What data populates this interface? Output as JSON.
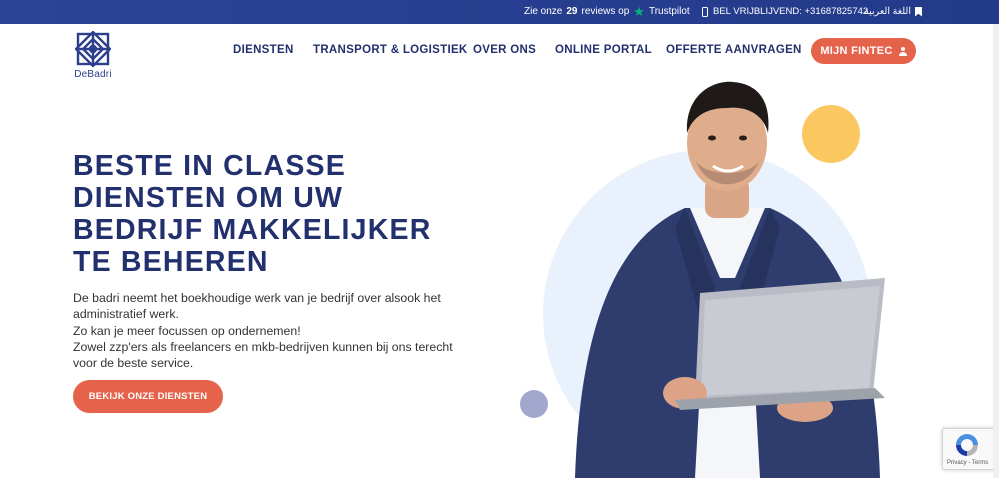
{
  "topbar": {
    "reviews_prefix": "Zie onze",
    "reviews_count": "29",
    "reviews_suffix": "reviews op",
    "trustpilot": "Trustpilot",
    "phone": "BEL VRIJBLIJVEND: +31687825742",
    "language": "اللغة العربية"
  },
  "logo": {
    "name": "DeBadri"
  },
  "nav": {
    "items": [
      {
        "label": "DIENSTEN"
      },
      {
        "label": "TRANSPORT & LOGISTIEK"
      },
      {
        "label": "OVER ONS"
      },
      {
        "label": "ONLINE PORTAL"
      },
      {
        "label": "OFFERTE AANVRAGEN"
      }
    ],
    "fintec_button": "MIJN FINTEC"
  },
  "hero": {
    "title_lines": [
      "BESTE IN CLASSE",
      "DIENSTEN OM UW",
      "BEDRIJF MAKKELIJKER",
      "TE BEHEREN"
    ],
    "paragraphs": [
      "De badri neemt het boekhoudige werk van je bedrijf over alsook het administratief werk.",
      "Zo kan je meer focussen op ondernemen!",
      "Zowel zzp'ers als freelancers en mkb-bedrijven kunnen bij ons terecht voor de beste service."
    ],
    "cta": "BEKIJK ONZE DIENSTEN"
  },
  "recaptcha": {
    "footer": "Privacy - Terms"
  },
  "colors": {
    "primary": "#23306e",
    "accent": "#e4634a",
    "topbar": "#2c4496",
    "yellow": "#fbc760",
    "light_circle": "#e9f2fc"
  },
  "icons": [
    "star-icon",
    "phone-icon",
    "bookmark-icon",
    "user-icon",
    "recaptcha-icon"
  ]
}
